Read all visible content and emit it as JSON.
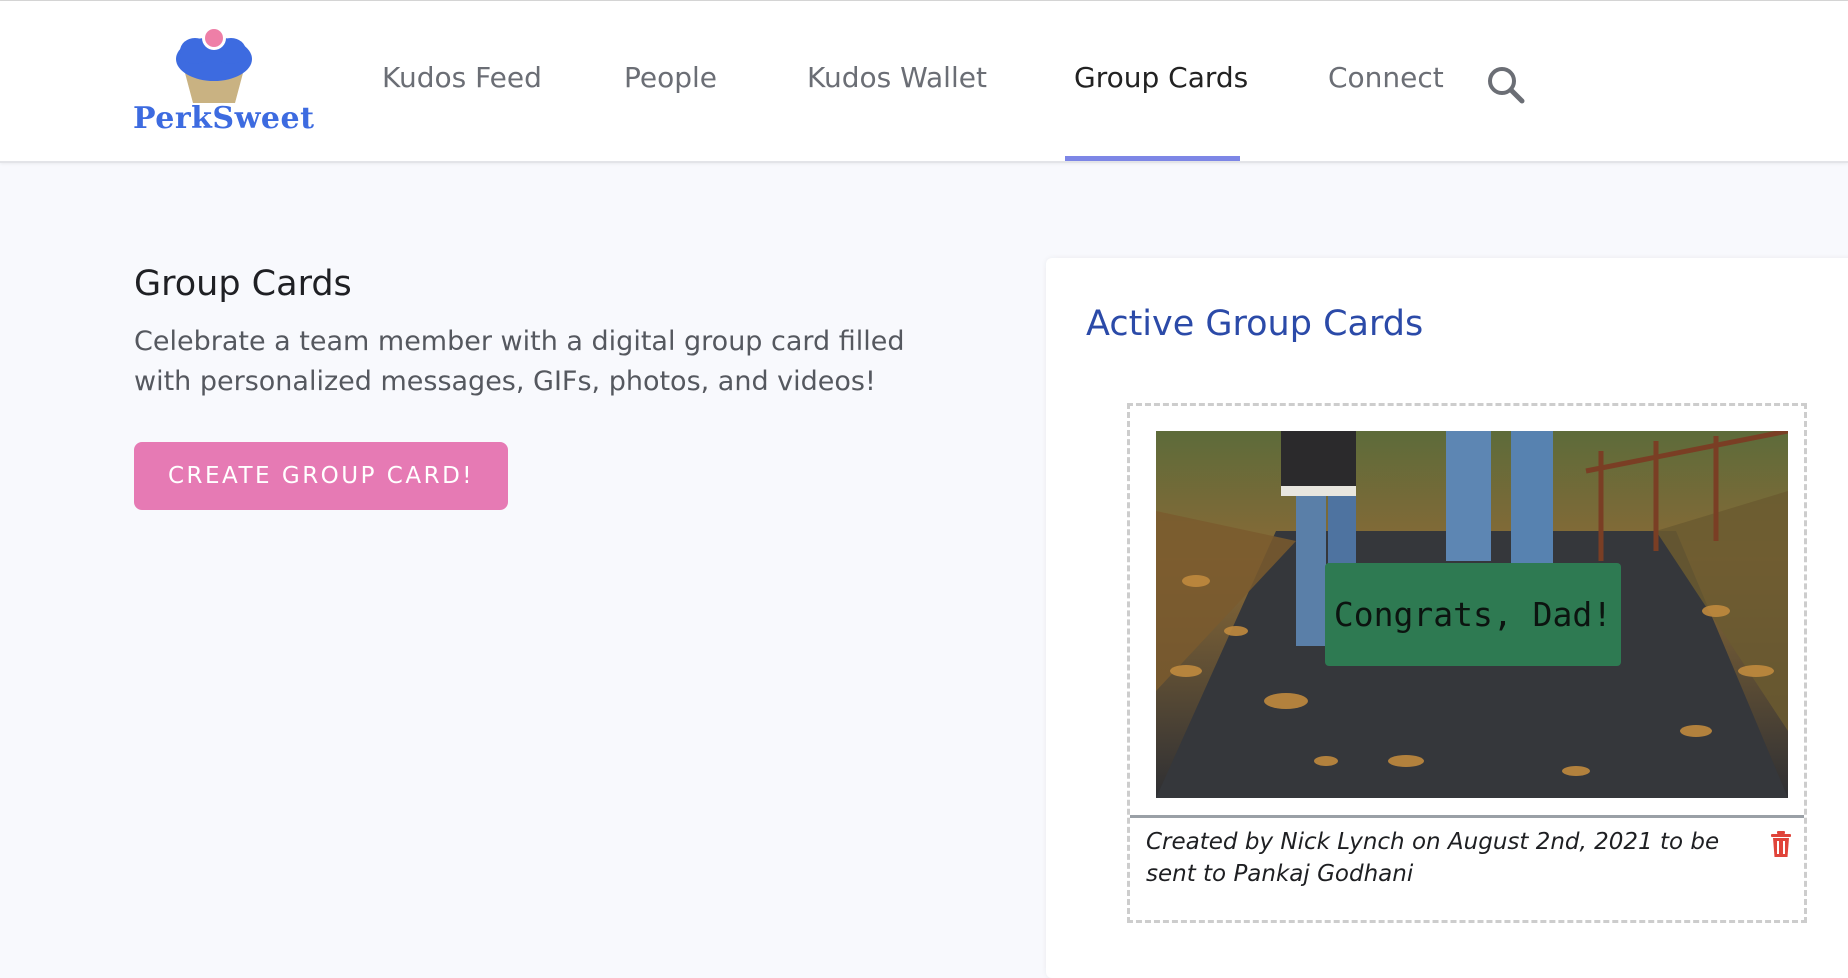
{
  "brand": {
    "name": "PerkSweet",
    "logo_icon": "cupcake-icon",
    "accent": "#3d6be0"
  },
  "nav": {
    "items": [
      {
        "label": "Kudos Feed",
        "active": false
      },
      {
        "label": "People",
        "active": false
      },
      {
        "label": "Kudos Wallet",
        "active": false
      },
      {
        "label": "Group Cards",
        "active": true
      },
      {
        "label": "Connect",
        "active": false
      }
    ],
    "search_icon": "search-icon",
    "underline_color": "#7d86e6"
  },
  "intro": {
    "title": "Group Cards",
    "description": "Celebrate a team member with a digital group card filled with personalized messages, GIFs, photos, and videos!",
    "create_button": "CREATE GROUP CARD!",
    "button_color": "#e67ab4"
  },
  "active_panel": {
    "title": "Active Group Cards",
    "cards": [
      {
        "banner_text": "Congrats, Dad!",
        "caption": "Created by Nick Lynch on August 2nd, 2021 to be sent to Pankaj Godhani",
        "delete_icon": "trash-icon"
      }
    ]
  }
}
